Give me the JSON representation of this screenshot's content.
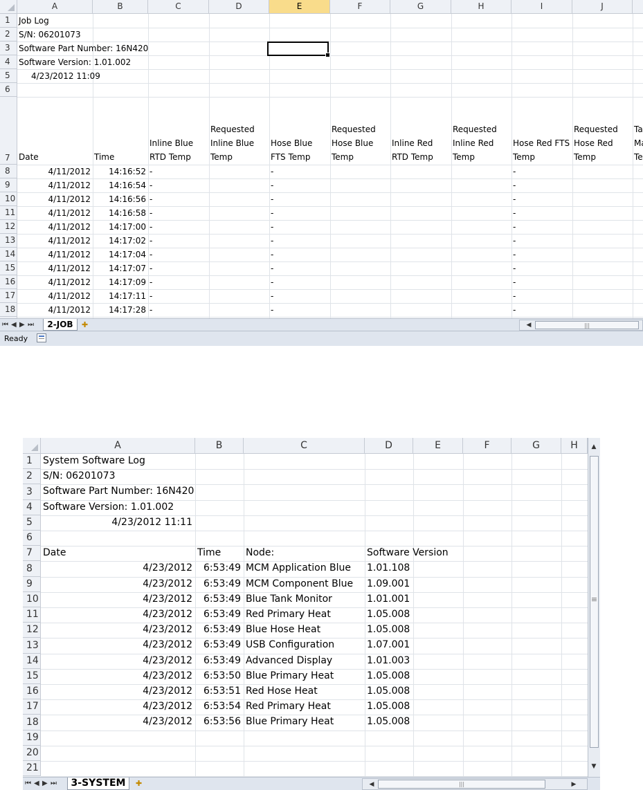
{
  "top": {
    "columns": [
      "A",
      "B",
      "C",
      "D",
      "E",
      "F",
      "G",
      "H",
      "I",
      "J",
      ""
    ],
    "rows": [
      "1",
      "2",
      "3",
      "4",
      "5",
      "6",
      "7",
      "8",
      "9",
      "10",
      "11",
      "12",
      "13",
      "14",
      "15",
      "16",
      "17",
      "18"
    ],
    "meta": {
      "title": "Job Log",
      "serial": "S/N: 06201073",
      "part_number": "Software Part Number: 16N420",
      "version": "Software Version: 1.01.002",
      "timestamp": "4/23/2012 11:09"
    },
    "headers": [
      {
        "line1": "",
        "line2": "",
        "line3": "Date"
      },
      {
        "line1": "",
        "line2": "",
        "line3": "Time"
      },
      {
        "line1": "",
        "line2": "Inline Blue",
        "line3": "RTD Temp"
      },
      {
        "line1": "Requested",
        "line2": "Inline Blue",
        "line3": "Temp"
      },
      {
        "line1": "",
        "line2": "Hose Blue",
        "line3": "FTS Temp"
      },
      {
        "line1": "Requested",
        "line2": "Hose Blue",
        "line3": "Temp"
      },
      {
        "line1": "",
        "line2": "Inline Red",
        "line3": "RTD Temp"
      },
      {
        "line1": "Requested",
        "line2": "Inline Red",
        "line3": "Temp"
      },
      {
        "line1": "",
        "line2": "Hose Red FTS",
        "line3": "Temp"
      },
      {
        "line1": "Requested",
        "line2": "Hose Red",
        "line3": "Temp"
      },
      {
        "line1": "Tan",
        "line2": "Ma",
        "line3": "Ter"
      }
    ],
    "data_rows": [
      {
        "date": "4/11/2012",
        "time": "14:16:52",
        "c": "-",
        "e": "-",
        "i": "-"
      },
      {
        "date": "4/11/2012",
        "time": "14:16:54",
        "c": "-",
        "e": "-",
        "i": "-"
      },
      {
        "date": "4/11/2012",
        "time": "14:16:56",
        "c": "-",
        "e": "-",
        "i": "-"
      },
      {
        "date": "4/11/2012",
        "time": "14:16:58",
        "c": "-",
        "e": "-",
        "i": "-"
      },
      {
        "date": "4/11/2012",
        "time": "14:17:00",
        "c": "-",
        "e": "-",
        "i": "-"
      },
      {
        "date": "4/11/2012",
        "time": "14:17:02",
        "c": "-",
        "e": "-",
        "i": "-"
      },
      {
        "date": "4/11/2012",
        "time": "14:17:04",
        "c": "-",
        "e": "-",
        "i": "-"
      },
      {
        "date": "4/11/2012",
        "time": "14:17:07",
        "c": "-",
        "e": "-",
        "i": "-"
      },
      {
        "date": "4/11/2012",
        "time": "14:17:09",
        "c": "-",
        "e": "-",
        "i": "-"
      },
      {
        "date": "4/11/2012",
        "time": "14:17:11",
        "c": "-",
        "e": "-",
        "i": "-"
      },
      {
        "date": "4/11/2012",
        "time": "14:17:28",
        "c": "-",
        "e": "-",
        "i": "-"
      }
    ],
    "sheet_tab": "2-JOB",
    "status": "Ready",
    "nav_first": "⏮",
    "nav_prev": "◀",
    "nav_next": "▶",
    "nav_last": "⏭",
    "new_tab_icon": "✚"
  },
  "bottom": {
    "columns": [
      "A",
      "B",
      "C",
      "D",
      "E",
      "F",
      "G",
      "H"
    ],
    "rows": [
      "1",
      "2",
      "3",
      "4",
      "5",
      "6",
      "7",
      "8",
      "9",
      "10",
      "11",
      "12",
      "13",
      "14",
      "15",
      "16",
      "17",
      "18",
      "19",
      "20",
      "21"
    ],
    "meta": {
      "title": "System Software Log",
      "serial": "S/N: 06201073",
      "part_number": "Software Part Number: 16N420",
      "version": "Software Version: 1.01.002",
      "timestamp": "4/23/2012 11:11"
    },
    "headers": {
      "date": "Date",
      "time": "Time",
      "node": "Node:",
      "version": "Software Version"
    },
    "data_rows": [
      {
        "date": "4/23/2012",
        "time": "6:53:49",
        "node": "MCM Application Blue",
        "version": "1.01.108"
      },
      {
        "date": "4/23/2012",
        "time": "6:53:49",
        "node": "MCM Component Blue",
        "version": "1.09.001"
      },
      {
        "date": "4/23/2012",
        "time": "6:53:49",
        "node": "Blue Tank Monitor",
        "version": "1.01.001"
      },
      {
        "date": "4/23/2012",
        "time": "6:53:49",
        "node": "Red Primary Heat",
        "version": "1.05.008"
      },
      {
        "date": "4/23/2012",
        "time": "6:53:49",
        "node": "Blue Hose Heat",
        "version": "1.05.008"
      },
      {
        "date": "4/23/2012",
        "time": "6:53:49",
        "node": "USB Configuration",
        "version": "1.07.001"
      },
      {
        "date": "4/23/2012",
        "time": "6:53:49",
        "node": "Advanced Display",
        "version": "1.01.003"
      },
      {
        "date": "4/23/2012",
        "time": "6:53:50",
        "node": "Blue Primary Heat",
        "version": "1.05.008"
      },
      {
        "date": "4/23/2012",
        "time": "6:53:51",
        "node": "Red Hose Heat",
        "version": "1.05.008"
      },
      {
        "date": "4/23/2012",
        "time": "6:53:54",
        "node": "Red Primary Heat",
        "version": "1.05.008"
      },
      {
        "date": "4/23/2012",
        "time": "6:53:56",
        "node": "Blue Primary Heat",
        "version": "1.05.008"
      }
    ],
    "sheet_tab": "3-SYSTEM",
    "nav_first": "⏮",
    "nav_prev": "◀",
    "nav_next": "▶",
    "nav_last": "⏭",
    "new_tab_icon": "✚",
    "scroll_up": "▲",
    "scroll_down": "▼",
    "scroll_left": "◀",
    "scroll_right": "▶",
    "scroll_grip": "≡",
    "hscroll_grip": "|||"
  }
}
